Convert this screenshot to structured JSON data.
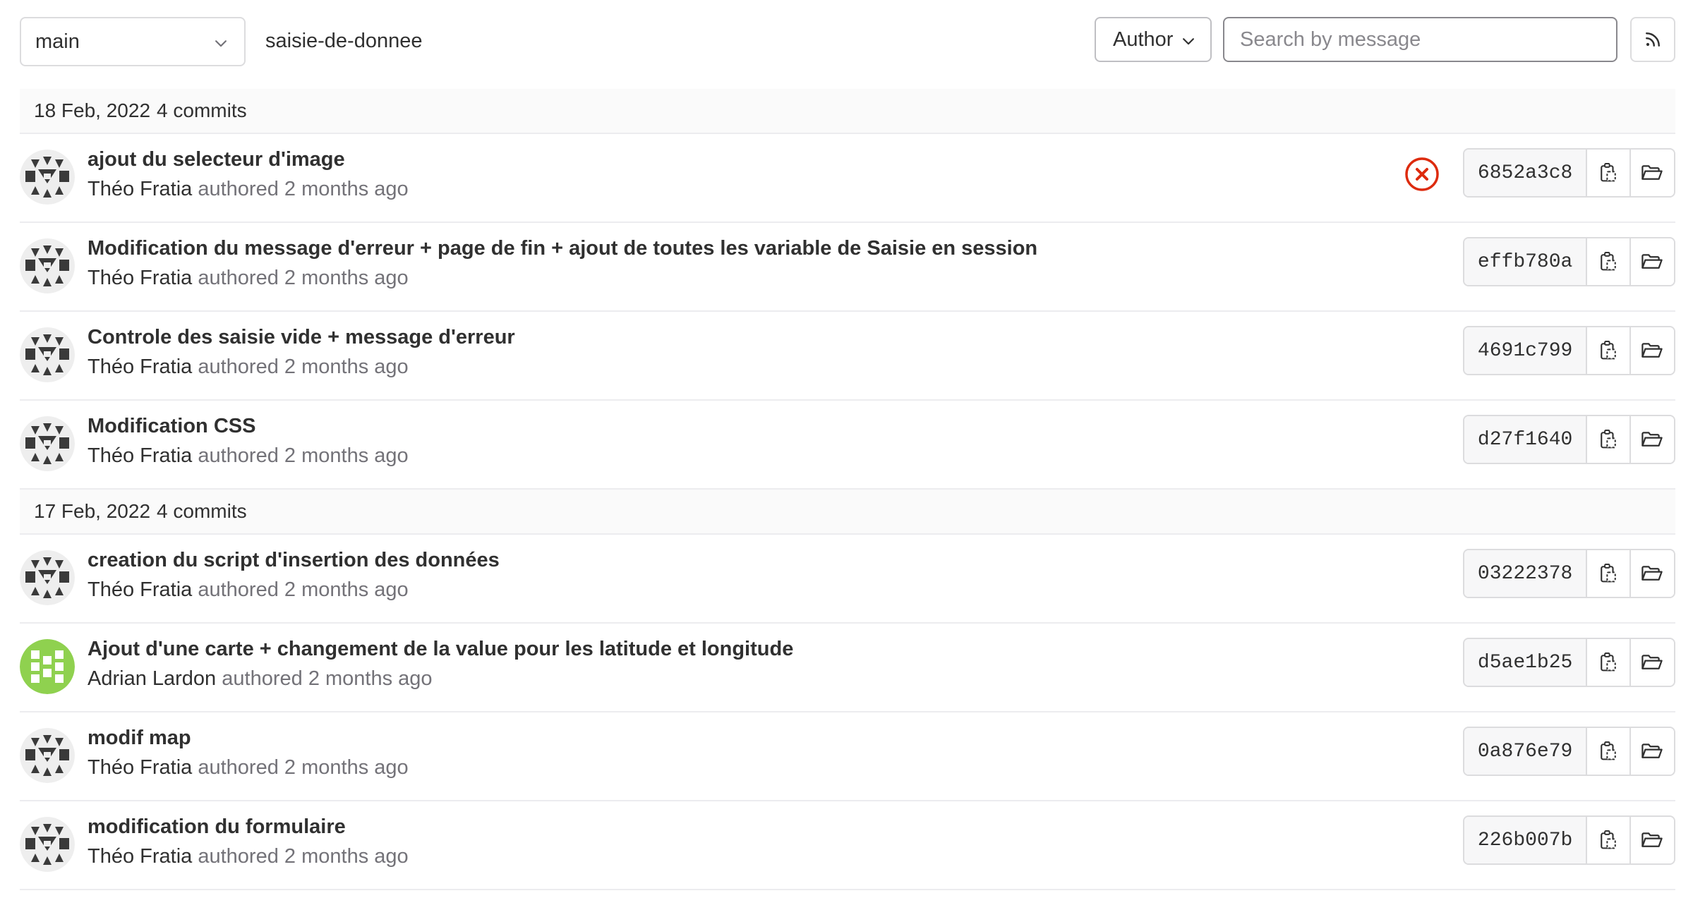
{
  "toolbar": {
    "branch": "main",
    "branch_icon": "chevron-down-icon",
    "path": "saisie-de-donnee",
    "author_label": "Author",
    "search_placeholder": "Search by message",
    "rss_icon": "rss-icon"
  },
  "colors": {
    "failed_status": "#dd2b0e",
    "avatar_dark": "#3a3a3a",
    "avatar_green": "#8fd14f"
  },
  "groups": [
    {
      "date": "18 Feb, 2022",
      "count": "4 commits",
      "commits": [
        {
          "title": "ajout du selecteur d'image",
          "author": "Théo Fratia",
          "authored": "authored",
          "time": "2 months ago",
          "sha": "6852a3c8",
          "status": "failed",
          "avatar": "dark"
        },
        {
          "title": "Modification du message d'erreur + page de fin + ajout de toutes les variable de Saisie en session",
          "author": "Théo Fratia",
          "authored": "authored",
          "time": "2 months ago",
          "sha": "effb780a",
          "status": "",
          "avatar": "dark"
        },
        {
          "title": "Controle des saisie vide + message d'erreur",
          "author": "Théo Fratia",
          "authored": "authored",
          "time": "2 months ago",
          "sha": "4691c799",
          "status": "",
          "avatar": "dark"
        },
        {
          "title": "Modification CSS",
          "author": "Théo Fratia",
          "authored": "authored",
          "time": "2 months ago",
          "sha": "d27f1640",
          "status": "",
          "avatar": "dark"
        }
      ]
    },
    {
      "date": "17 Feb, 2022",
      "count": "4 commits",
      "commits": [
        {
          "title": "creation du script d'insertion des données",
          "author": "Théo Fratia",
          "authored": "authored",
          "time": "2 months ago",
          "sha": "03222378",
          "status": "",
          "avatar": "dark"
        },
        {
          "title": "Ajout d'une carte + changement de la value pour les latitude et longitude",
          "author": "Adrian Lardon",
          "authored": "authored",
          "time": "2 months ago",
          "sha": "d5ae1b25",
          "status": "",
          "avatar": "green"
        },
        {
          "title": "modif map",
          "author": "Théo Fratia",
          "authored": "authored",
          "time": "2 months ago",
          "sha": "0a876e79",
          "status": "",
          "avatar": "dark"
        },
        {
          "title": "modification du formulaire",
          "author": "Théo Fratia",
          "authored": "authored",
          "time": "2 months ago",
          "sha": "226b007b",
          "status": "",
          "avatar": "dark"
        }
      ]
    }
  ]
}
